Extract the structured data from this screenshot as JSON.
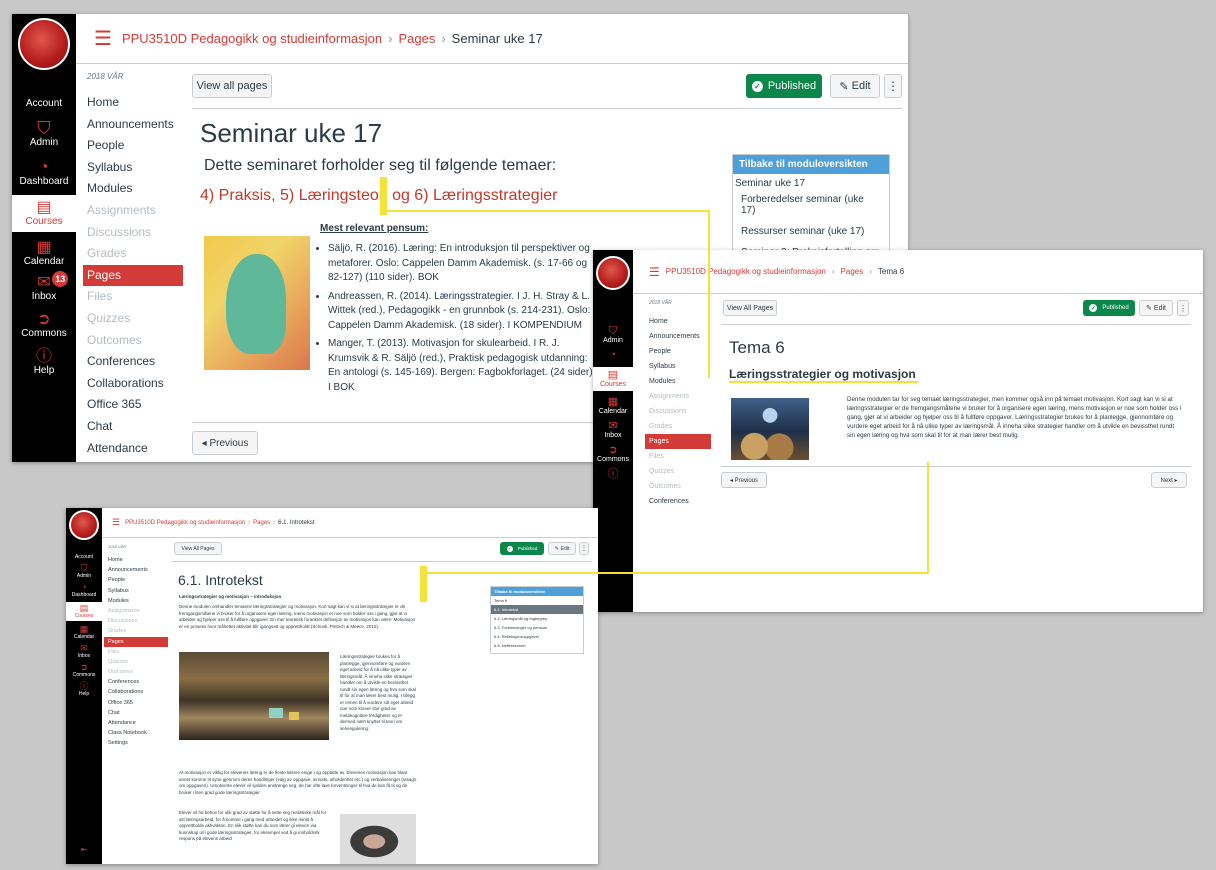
{
  "shot1": {
    "rail": [
      "Account",
      "Admin",
      "Dashboard",
      "Courses",
      "Calendar",
      "Inbox",
      "Commons",
      "Help"
    ],
    "inbox_badge": "13",
    "breadcrumb": {
      "course": "PPU3510D Pedagogikk og studieinformasjon",
      "pages": "Pages",
      "current": "Seminar uke 17"
    },
    "term": "2018 VÅR",
    "nav": [
      "Home",
      "Announcements",
      "People",
      "Syllabus",
      "Modules",
      "Assignments",
      "Discussions",
      "Grades",
      "Pages",
      "Files",
      "Quizzes",
      "Outcomes",
      "Conferences",
      "Collaborations",
      "Office 365",
      "Chat",
      "Attendance"
    ],
    "view_all": "View all pages",
    "published": "Published",
    "edit": "Edit",
    "more": "⋮",
    "title": "Seminar uke 17",
    "intro": "Dette seminaret forholder seg til følgende temaer:",
    "themes": "4) Praksis, 5) Læringsteori og 6) Læringsstrategier",
    "pensum_heading": "Mest relevant pensum:",
    "refs": [
      "Säljö, R. (2016). Læring: En introduksjon til perspektiver og metaforer. Oslo: Cappelen Damm Akademisk. (s. 17-66 og 82-127) (110 sider). BOK",
      "Andreassen, R. (2014). Læringsstrategier. I J. H. Stray & L. Wittek (red.), Pedagogikk - en grunnbok (s. 214-231). Oslo: Cappelen Damm Akademisk. (18 sider). I KOMPENDIUM",
      "Manger, T. (2013). Motivasjon for skulearbeid. I R. J. Krumsvik & R. Säljö (red.), Praktisk pedagogisk utdanning: En antologi (s. 145-169). Bergen: Fagbokforlaget. (24 sider). I BOK"
    ],
    "module_box": {
      "header": "Tilbake til moduloversikten",
      "items": [
        "Seminar uke 17",
        "Forberedelser seminar (uke 17)",
        "Ressurser seminar (uke 17)",
        "Seminar 3: Praksisfortelling om motivasjon"
      ]
    },
    "previous": "◂ Previous"
  },
  "shot2": {
    "rail": [
      "Admin",
      "Courses",
      "Calendar",
      "Inbox",
      "Commons"
    ],
    "breadcrumb": {
      "course": "PPU3510D Pedagogikk og studieinformasjon",
      "pages": "Pages",
      "current": "Tema 6"
    },
    "term": "2018 VÅR",
    "nav": [
      "Home",
      "Announcements",
      "People",
      "Syllabus",
      "Modules",
      "Assignments",
      "Discussions",
      "Grades",
      "Pages",
      "Files",
      "Quizzes",
      "Outcomes",
      "Conferences"
    ],
    "view_all": "View All Pages",
    "published": "Published",
    "edit": "Edit",
    "more": "⋮",
    "title": "Tema 6",
    "subtitle": "Læringsstrategier og motivasjon",
    "body": "Denne modulen tar for seg temaet læringsstrategier, men kommer også inn på temaet motivasjon. Kort sagt kan vi si at læringsstrategier er de fremgangsmåtene vi bruker for å organisere egen læring, mens motivasjon er noe som holder oss i gang, gjør at vi arbeider og hjelper oss til å fullføre oppgaver. Læringsstrategier brukes for å planlegge, gjennomføre og vurdere eget arbeid for å nå ulike typer av læringsmål. Å inneha slike strategier handler om å utvikle en bevissthet rundt sin egen læring og hva som skal til for at man lærer best mulig.",
    "previous": "◂ Previous",
    "next": "Next ▸"
  },
  "shot3": {
    "rail": [
      "Account",
      "Admin",
      "Dashboard",
      "Courses",
      "Calendar",
      "Inbox",
      "Commons",
      "Help"
    ],
    "breadcrumb": {
      "course": "PPU3510D Pedagogikk og studieinformasjon",
      "pages": "Pages",
      "current": "6.1. Introtekst"
    },
    "term": "2018 VÅR",
    "nav": [
      "Home",
      "Announcements",
      "People",
      "Syllabus",
      "Modules",
      "Assignments",
      "Discussions",
      "Grades",
      "Pages",
      "Files",
      "Quizzes",
      "Outcomes",
      "Conferences",
      "Collaborations",
      "Office 365",
      "Chat",
      "Attendance",
      "Class Notebook",
      "Settings"
    ],
    "view_all": "View All Pages",
    "published": "Published",
    "edit": "Edit",
    "more": "⋮",
    "title": "6.1. Introtekst",
    "subtitle": "Læringsstrategier og motivasjon – introduksjon",
    "p1": "Denne modulen omhandler temaene læringsstrategier og motivasjon. Kort sagt kan vi si at læringsstrategier er de fremgangsmåtene vi bruker for å organisere egen læring, mens motivasjon er noe som holder oss i gang, gjør at vi arbeider og hjelper oss til å fullføre oppgaver. En mer teoretisk forankret definisjon av motivasjon kan være: Motivasjon er en prosess hvor målrettet aktivitet blir igangsatt og opprettholdt (Schunk, Pintrich & Meece, 2010).",
    "p2": "Læringsstrategier brukes for å planlegge, gjennomføre og vurdere eget arbeid for å nå ulike typer av læringsmål. Å inneha slike strategier handler om å utvikle en bevissthet rundt sin egen læring og hva som skal til for at man lærer best mulig. I tillegg er evnen til å vurdere sitt eget arbeid noe som krever stor grad av metakognitive ferdigheter og er dermed nært knyttet til teori om selvregulering.",
    "p3": "At motivasjon er viktig for elevenes læring er de fleste lærere enige i og opptatte av. Elevenes motivasjon kan blant annet komme til syne gjennom deres handlinger (valg av oppgave, innsats, utholdenhet etc.) og verbaliseringer (utsagn om oppgaven). Umotiverte elever vil sjelden anstrenge seg, de har ofte lave forventninger til hva de kan få til og de bruker i liten grad gode læringsstrategier.",
    "p4": "Elever vil ha behov for ulik grad av støtte for å sette seg realistiske mål for sitt læringsarbeid, for å komme i gang med arbeidet og ikke minst å opprettholde aktiviteten. En slik støtte kan du som lærer gi eleven via kunnskap om gode læringsstrategier, for eksempel ved å gi innholdsrik respons på elevens arbeid",
    "module_box": {
      "header": "Tilbake til moduloversikten",
      "items": [
        "Tema 6",
        "6.1. Introtekst",
        "6.2. Læringsmål og fagbegrep",
        "6.3. Forelesninger og pensum",
        "6.4. Refleksjonsoppgaver",
        "6.5. Nettressurser"
      ]
    }
  }
}
